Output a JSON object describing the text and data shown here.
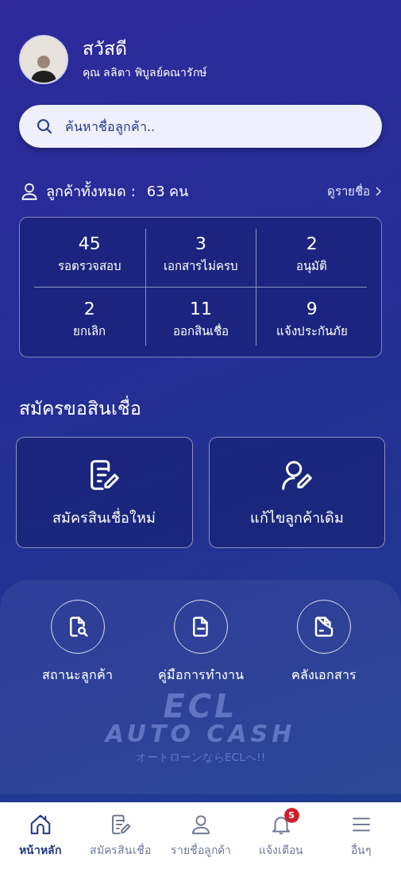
{
  "header": {
    "greeting": "สวัสดี",
    "user_name": "คุณ ลลิตา พิบูลย์คณารักษ์"
  },
  "search": {
    "placeholder": "ค้นหาชื่อลูกค้า.."
  },
  "customer_summary": {
    "label": "ลูกค้าทั้งหมด :",
    "count": "63 คน",
    "link": "ดูรายชื่อ"
  },
  "stats": [
    {
      "value": "45",
      "label": "รอตรวจสอบ"
    },
    {
      "value": "3",
      "label": "เอกสารไม่ครบ"
    },
    {
      "value": "2",
      "label": "อนุมัติ"
    },
    {
      "value": "2",
      "label": "ยกเลิก"
    },
    {
      "value": "11",
      "label": "ออกสินเชื่อ"
    },
    {
      "value": "9",
      "label": "แจ้งประกันภัย"
    }
  ],
  "loan_section": {
    "title": "สมัครขอสินเชื่อ",
    "actions": [
      {
        "kind": "new",
        "label": "สมัครสินเชื่อใหม่"
      },
      {
        "kind": "edit",
        "label": "แก้ไขลูกค้าเดิม"
      }
    ]
  },
  "shortcuts": [
    {
      "kind": "status",
      "label": "สถานะลูกค้า"
    },
    {
      "kind": "manual",
      "label": "คู่มือการทำงาน"
    },
    {
      "kind": "documents",
      "label": "คลังเอกสาร"
    }
  ],
  "brand_logo": {
    "name": "ECL",
    "line2": "AUTO CASH",
    "tagline": "オートローンならECLへ!!"
  },
  "bottom_nav": [
    {
      "kind": "home",
      "label": "หน้าหลัก",
      "selected": true
    },
    {
      "kind": "apply",
      "label": "สมัครสินเชื่อ",
      "selected": false
    },
    {
      "kind": "customers",
      "label": "รายชื่อลูกค้า",
      "selected": false
    },
    {
      "kind": "alerts",
      "label": "แจ้งเตือน",
      "selected": false,
      "badge": "5"
    },
    {
      "kind": "more",
      "label": "อื่นๆ",
      "selected": false
    }
  ]
}
